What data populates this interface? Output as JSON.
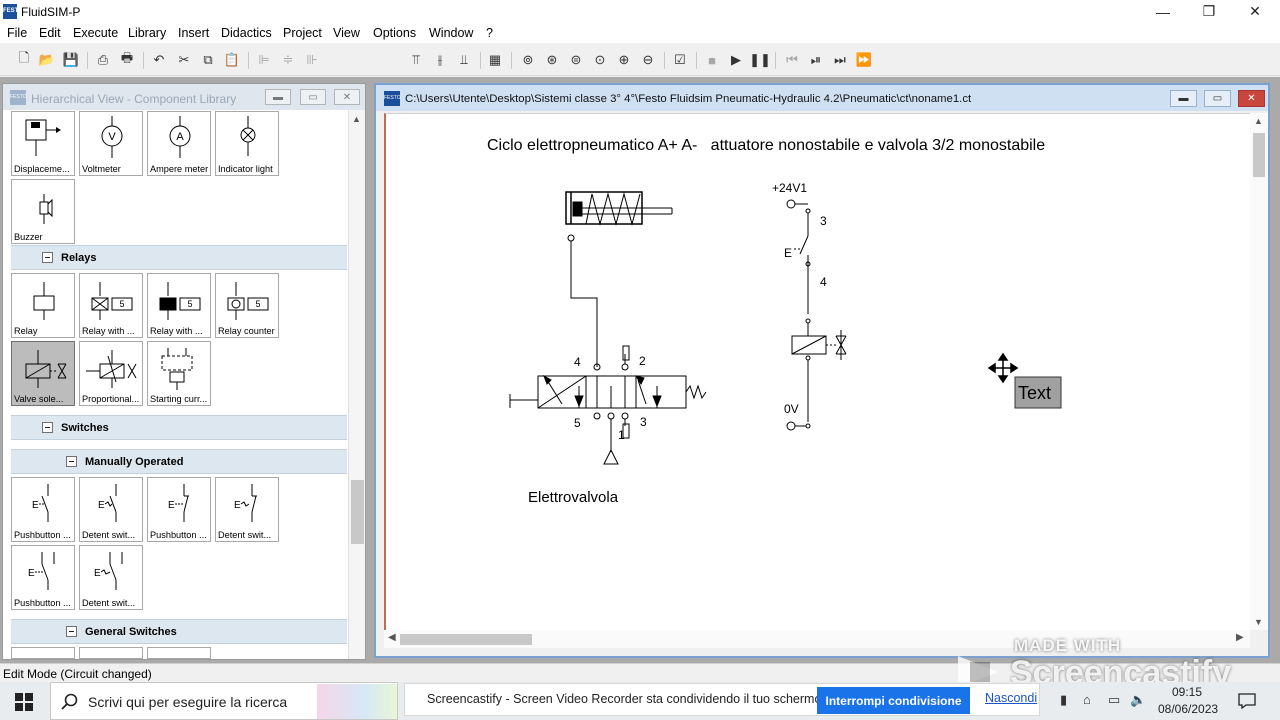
{
  "window": {
    "title": "FluidSIM-P",
    "logo_text": "FESTO",
    "min_glyph": "—",
    "max_glyph": "❐",
    "close_glyph": "✕"
  },
  "menu": [
    "File",
    "Edit",
    "Execute",
    "Library",
    "Insert",
    "Didactics",
    "Project",
    "View",
    "Options",
    "Window",
    "?"
  ],
  "toolbar_icons": [
    "new-icon",
    "open-icon",
    "save-icon",
    "print-preview-icon",
    "print-icon",
    "undo-icon",
    "cut-icon",
    "copy-icon",
    "paste-icon",
    "align-left-icon",
    "align-center-icon",
    "align-right-icon",
    "align-top-icon",
    "align-middle-icon",
    "align-bottom-icon",
    "grid-icon",
    "zoom-1to1-icon",
    "zoom-circuit-icon",
    "zoom-window-icon",
    "zoom-region-icon",
    "zoom-in-icon",
    "zoom-out-icon",
    "check-drawing-icon",
    "stop-icon",
    "play-icon",
    "pause-icon",
    "reset-icon",
    "step-icon",
    "step-forward-icon",
    "fast-forward-icon"
  ],
  "library": {
    "title": "Hierarchical View - Component Library",
    "tiles_top": [
      {
        "label": "Displaceme..."
      },
      {
        "label": "Voltmeter",
        "symbol": "V"
      },
      {
        "label": "Ampere meter",
        "symbol": "A"
      },
      {
        "label": "Indicator light"
      },
      {
        "label": "Buzzer"
      }
    ],
    "groups": {
      "relays": "Relays",
      "switches": "Switches",
      "manually_operated": "Manually Operated",
      "general_switches": "General Switches"
    },
    "relays": [
      {
        "label": "Relay"
      },
      {
        "label": "Relay with ...",
        "symbol": "5"
      },
      {
        "label": "Relay with ...",
        "symbol": "5"
      },
      {
        "label": "Relay counter",
        "symbol": "5"
      },
      {
        "label": "Valve sole..."
      },
      {
        "label": "Proportional..."
      },
      {
        "label": "Starting curr..."
      }
    ],
    "manual_switches": [
      {
        "label": "Pushbutton ..."
      },
      {
        "label": "Detent swit..."
      },
      {
        "label": "Pushbutton ..."
      },
      {
        "label": "Detent swit..."
      },
      {
        "label": "Pushbutton ..."
      },
      {
        "label": "Detent swit..."
      }
    ]
  },
  "circuit": {
    "path": "C:\\Users\\Utente\\Desktop\\Sistemi classe 3° 4°\\Festo Fluidsim Pneumatic-Hydraulic 4.2\\Pneumatic\\ct\\noname1.ct",
    "heading": "Ciclo elettropneumatico A+ A-   attuatore nonostabile e valvola 3/2 monostabile",
    "valve_caption": "Elettrovalvola",
    "supply_label": "+24V1",
    "ground_label": "0V",
    "switch_label": "E",
    "port_labels": [
      "4",
      "2",
      "5",
      "1",
      "3"
    ],
    "contact_labels": [
      "3",
      "4"
    ],
    "text_box": "Text"
  },
  "status": {
    "text": "Edit Mode (Circuit changed)"
  },
  "taskbar": {
    "search_placeholder": "Scrivi qui per eseguire la ricerca",
    "notice": "Screencastify - Screen Video Recorder sta condividendo il tuo schermo.",
    "stop_share": "Interrompi condivisione",
    "hide": "Nascondi",
    "time": "09:15",
    "date": "08/06/2023"
  },
  "watermark": {
    "line1": "MADE WITH",
    "line2": "Screencastify"
  }
}
